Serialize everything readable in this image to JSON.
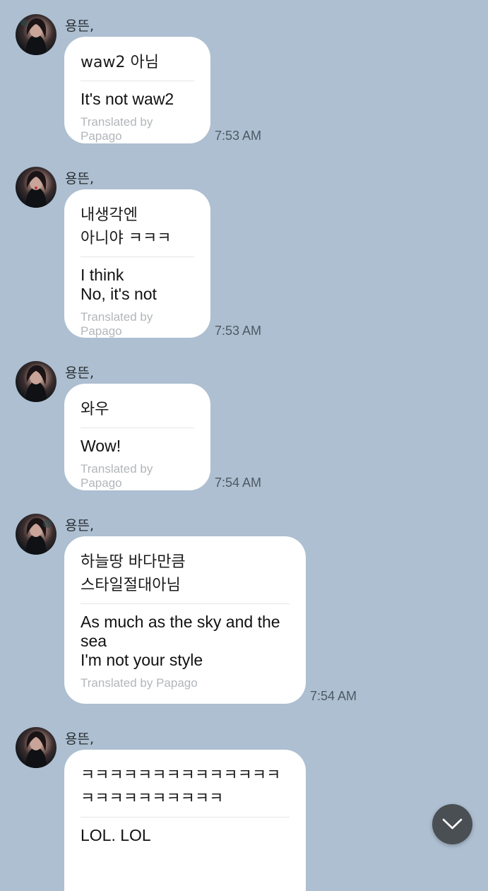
{
  "messages": [
    {
      "sender": "용뜬,",
      "original": "waw2 아님",
      "translation": "It's not waw2",
      "credit": "Translated by Papago",
      "time": "7:53 AM"
    },
    {
      "sender": "용뜬,",
      "original": "내생각엔\n아니야 ㅋㅋㅋ",
      "translation": "I think\nNo, it's not",
      "credit": "Translated by Papago",
      "time": "7:53 AM"
    },
    {
      "sender": "용뜬,",
      "original": "와우",
      "translation": "Wow!",
      "credit": "Translated by Papago",
      "time": "7:54 AM"
    },
    {
      "sender": "용뜬,",
      "original": "하늘땅 바다만큼\n스타일절대아님",
      "translation": "As much as the sky and the\nsea\nI'm not your style",
      "credit": "Translated by Papago",
      "time": "7:54 AM"
    },
    {
      "sender": "용뜬,",
      "original": "ㅋㅋㅋㅋㅋㅋㅋㅋㅋㅋㅋㅋㅋㅋ\nㅋㅋㅋㅋㅋㅋㅋㅋㅋㅋ",
      "translation": "LOL. LOL",
      "credit": "",
      "time": ""
    }
  ],
  "scroll_button": {
    "icon": "chevron-down-icon"
  },
  "colors": {
    "background": "#adbfd1",
    "bubble": "#ffffff",
    "scroll_button": "#4a4f54"
  }
}
